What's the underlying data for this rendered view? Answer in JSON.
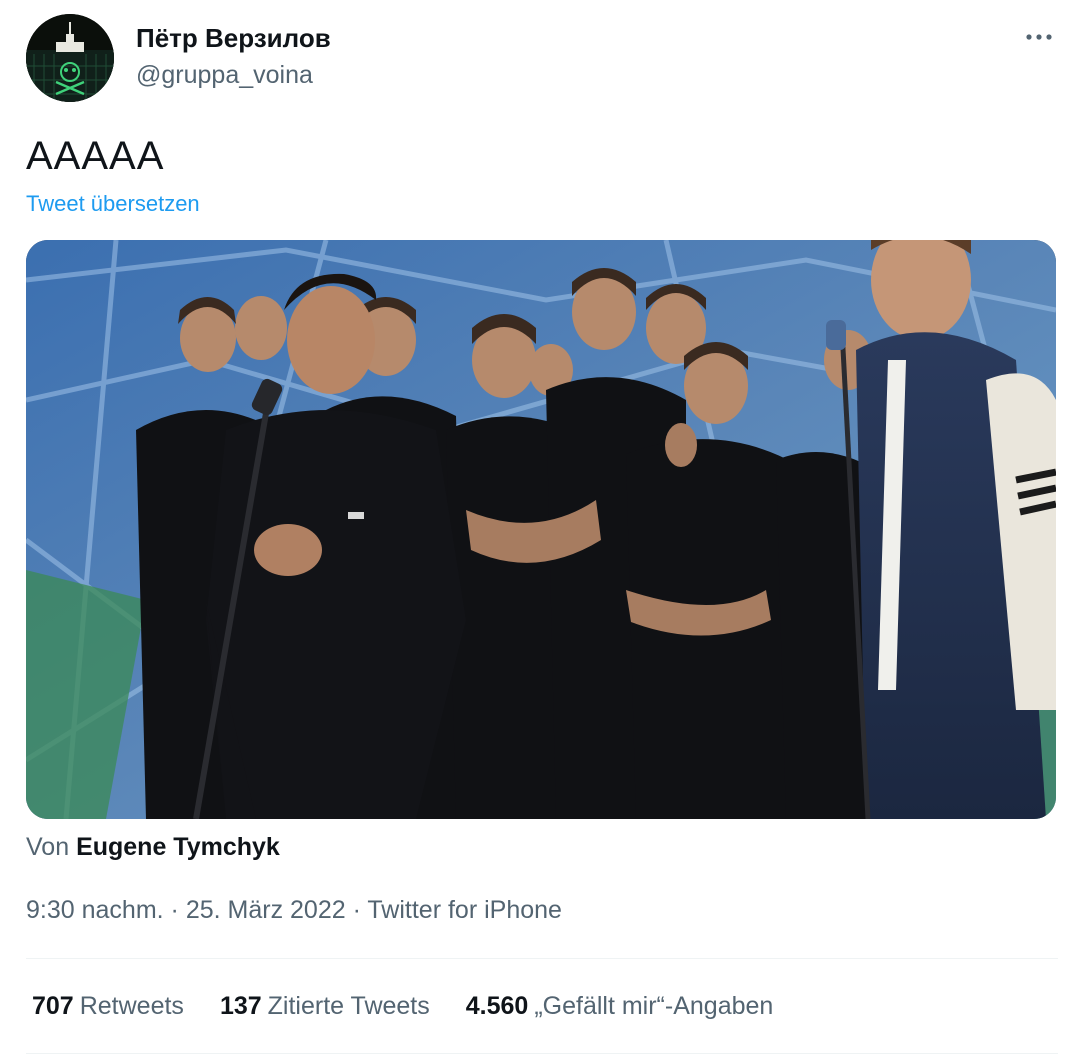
{
  "author": {
    "display_name": "Пётр Верзилов",
    "handle": "@gruppa_voina"
  },
  "tweet": {
    "text": "AAAAA",
    "translate_link": "Tweet übersetzen"
  },
  "media": {
    "attribution_prefix": "Von",
    "attribution_name": "Eugene Tymchyk"
  },
  "meta": {
    "time": "9:30 nachm.",
    "date": "25. März 2022",
    "source": "Twitter for iPhone",
    "separator": " · "
  },
  "stats": [
    {
      "count": "707",
      "label": "Retweets"
    },
    {
      "count": "137",
      "label": "Zitierte Tweets"
    },
    {
      "count": "4.560",
      "label": "„Gefällt mir“-Angaben"
    }
  ],
  "colors": {
    "link": "#1d9bf0",
    "secondary_text": "#536471",
    "primary_text": "#0f1419",
    "divider": "#eff3f4"
  },
  "icons": {
    "more": "more-horizontal-icon"
  }
}
